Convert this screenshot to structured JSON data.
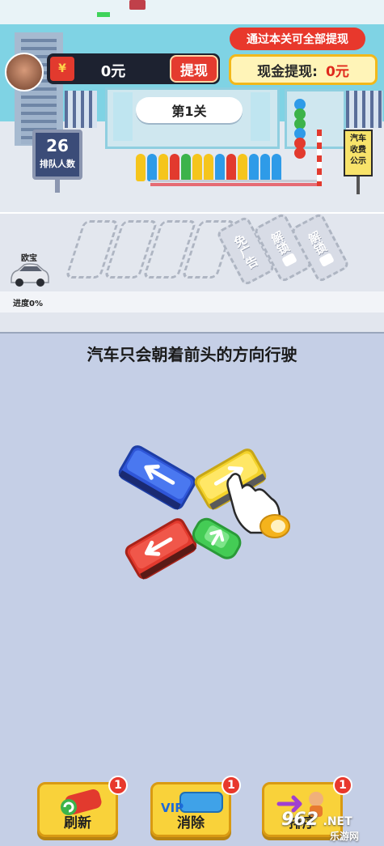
{
  "header": {
    "tip": "通过本关可全部提现",
    "money_value": "0元",
    "withdraw_label": "提现",
    "cash_label": "现金提现:",
    "cash_value": "0元",
    "level_title": "第1关"
  },
  "queue": {
    "count": "26",
    "label": "排队人数"
  },
  "fee_sign": {
    "line1": "汽车",
    "line2": "收费",
    "line3": "公示"
  },
  "parking": {
    "slots_locked": [
      {
        "label": "免广告"
      },
      {
        "label": "解锁"
      },
      {
        "label": "解锁"
      }
    ],
    "car_name": "欧宝",
    "progress_text": "进度0%"
  },
  "instruction": "汽车只会朝着前头的方向行驶",
  "bottom_buttons": [
    {
      "label": "刷新",
      "badge": "1"
    },
    {
      "label": "消除",
      "badge": "1",
      "icon_text": "VIP"
    },
    {
      "label": "排序",
      "badge": "1"
    }
  ],
  "watermark": {
    "line1": "962",
    "line2": "乐游网",
    "domain": ".NET"
  },
  "colors": {
    "bg": "#c5cfe6",
    "red": "#e8382c",
    "yellow": "#f9d23a",
    "blue_bus": "#2f56d8",
    "red_bus": "#e23a2e",
    "yellow_bus": "#f3d22a",
    "green_car": "#44cc55"
  }
}
